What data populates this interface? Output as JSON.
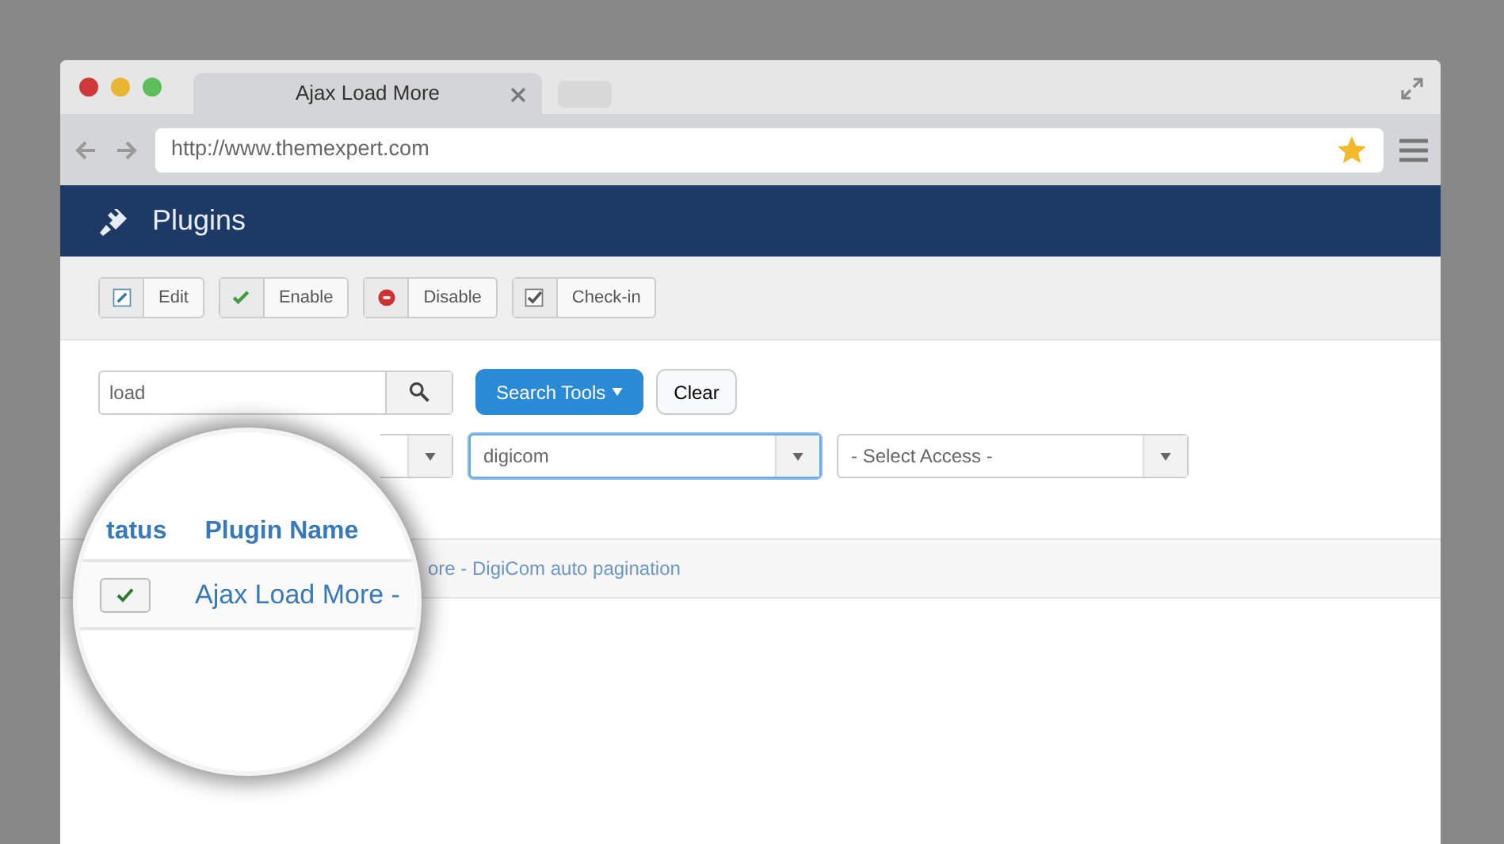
{
  "window": {
    "tab_title": "Ajax Load More",
    "url": "http://www.themexpert.com"
  },
  "header": {
    "title": "Plugins"
  },
  "toolbar": [
    {
      "kind": "edit",
      "label": "Edit"
    },
    {
      "kind": "enable",
      "label": "Enable"
    },
    {
      "kind": "disable",
      "label": "Disable"
    },
    {
      "kind": "checkin",
      "label": "Check-in"
    }
  ],
  "search": {
    "value": "load",
    "buttons": [
      "Search Tools",
      "Clear"
    ]
  },
  "filters": [
    {
      "value": "digicom",
      "focused": true
    },
    {
      "value": "- Select Access -",
      "focused": false
    }
  ],
  "behind_row_text": "ore - DigiCom auto pagination",
  "magnifier": {
    "columns": [
      "tatus",
      "Plugin Name"
    ],
    "rows": [
      {
        "enabled": true,
        "name": "Ajax Load More - "
      }
    ]
  }
}
